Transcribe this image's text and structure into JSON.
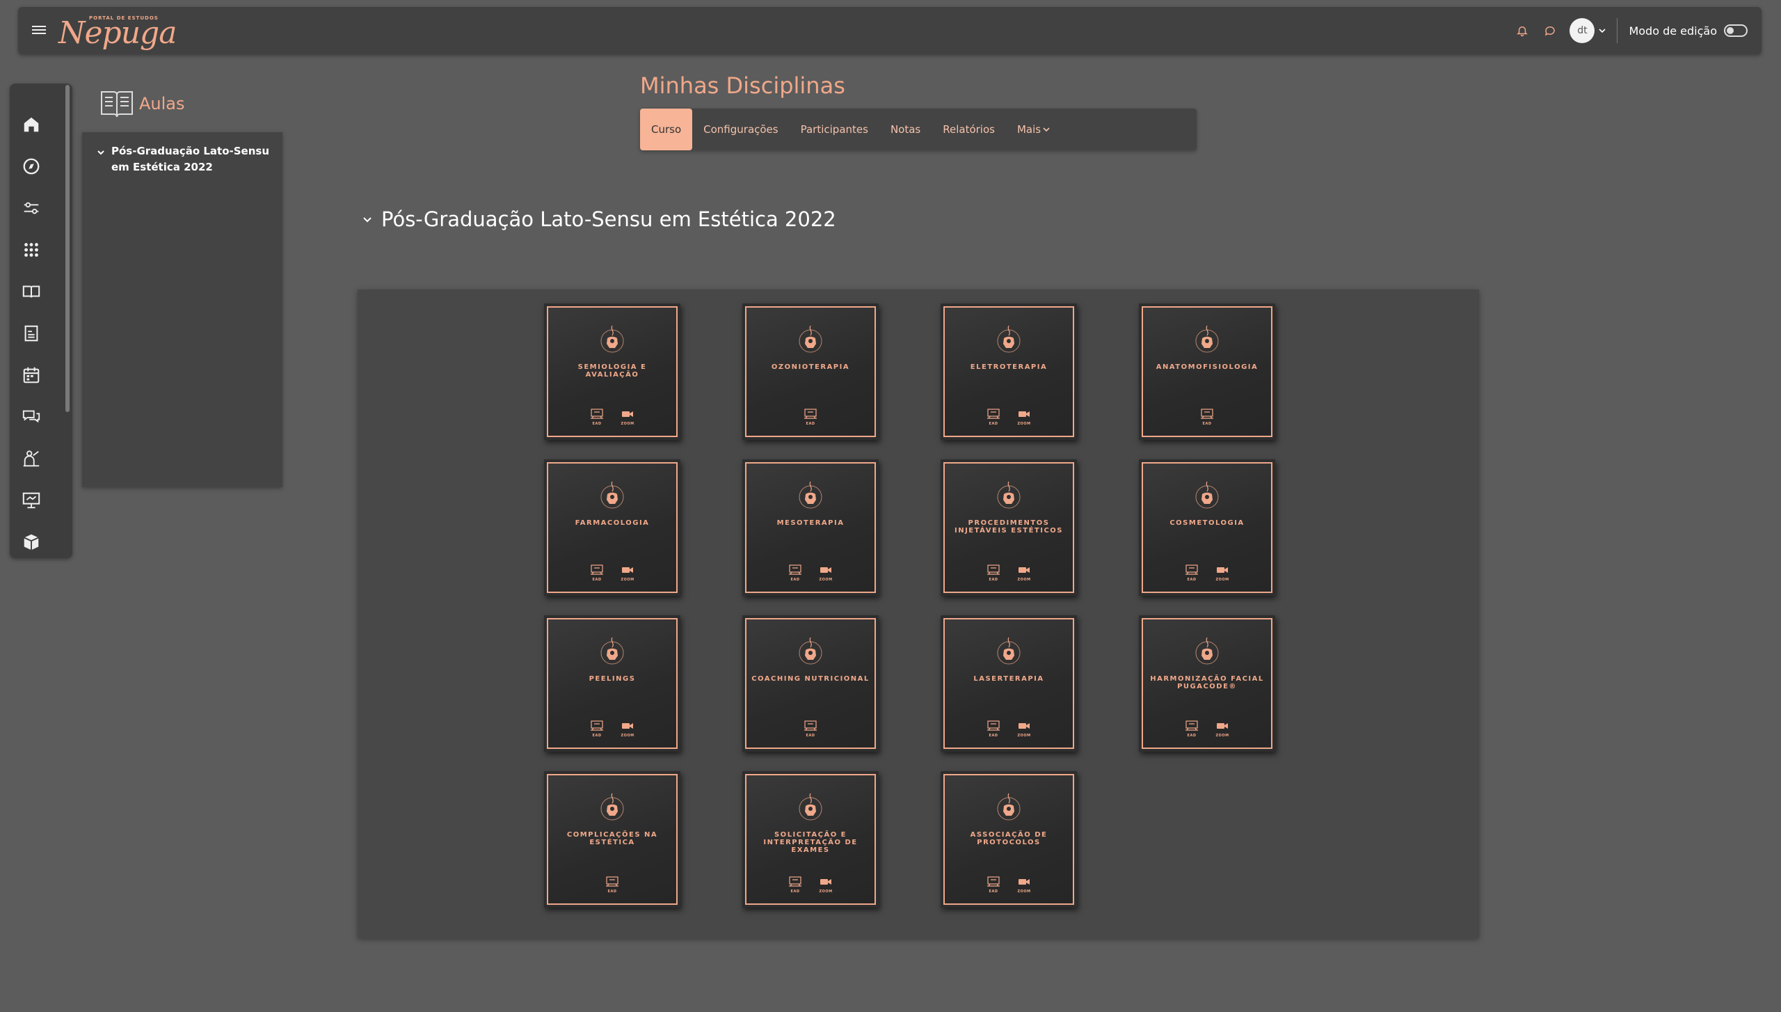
{
  "navbar": {
    "logo_small": "PORTAL DE ESTUDOS",
    "logo_script": "Nepuga",
    "avatar_initials": "dt",
    "edit_mode_label": "Modo de edição",
    "edit_mode_on": false
  },
  "rail": {
    "items": [
      "home-icon",
      "compass-icon",
      "sliders-icon",
      "apps-grid-icon",
      "book-icon",
      "grades-doc-icon",
      "calendar-icon",
      "chat-icon",
      "teacher-icon",
      "presentation-icon",
      "box-icon"
    ]
  },
  "drawer": {
    "title": "Aulas",
    "items": [
      {
        "label": "Pós-Graduação Lato-Sensu em Estética 2022"
      }
    ]
  },
  "page": {
    "title": "Minhas Disciplinas",
    "tabs": [
      "Curso",
      "Configurações",
      "Participantes",
      "Notas",
      "Relatórios",
      "Mais"
    ],
    "active_tab": "Curso"
  },
  "section": {
    "title": "Pós-Graduação Lato-Sensu em Estética 2022"
  },
  "colors": {
    "accent": "#f0a88a",
    "background": "#5c5c5c",
    "panel": "#484848"
  },
  "badge_labels": {
    "ead": "EAD",
    "zoom": "ZOOM"
  },
  "courses": [
    {
      "name": "Semiologia e Avaliação",
      "badges": [
        "ead",
        "zoom"
      ]
    },
    {
      "name": "Ozonioterapia",
      "badges": [
        "ead"
      ]
    },
    {
      "name": "Eletroterapia",
      "badges": [
        "ead",
        "zoom"
      ]
    },
    {
      "name": "Anatomofisiologia",
      "badges": [
        "ead"
      ]
    },
    {
      "name": "Farmacologia",
      "badges": [
        "ead",
        "zoom"
      ]
    },
    {
      "name": "Mesoterapia",
      "badges": [
        "ead",
        "zoom"
      ]
    },
    {
      "name": "Procedimentos Injetáveis Estéticos",
      "badges": [
        "ead",
        "zoom"
      ]
    },
    {
      "name": "Cosmetologia",
      "badges": [
        "ead",
        "zoom"
      ]
    },
    {
      "name": "Peelings",
      "badges": [
        "ead",
        "zoom"
      ]
    },
    {
      "name": "Coaching Nutricional",
      "badges": [
        "ead"
      ]
    },
    {
      "name": "Laserterapia",
      "badges": [
        "ead",
        "zoom"
      ]
    },
    {
      "name": "Harmonização Facial Pugacode®",
      "badges": [
        "ead",
        "zoom"
      ]
    },
    {
      "name": "Complicações na Estética",
      "badges": [
        "ead"
      ]
    },
    {
      "name": "Solicitação e Interpretação de Exames",
      "badges": [
        "ead",
        "zoom"
      ]
    },
    {
      "name": "Associação de Protocolos",
      "badges": [
        "ead",
        "zoom"
      ]
    }
  ]
}
